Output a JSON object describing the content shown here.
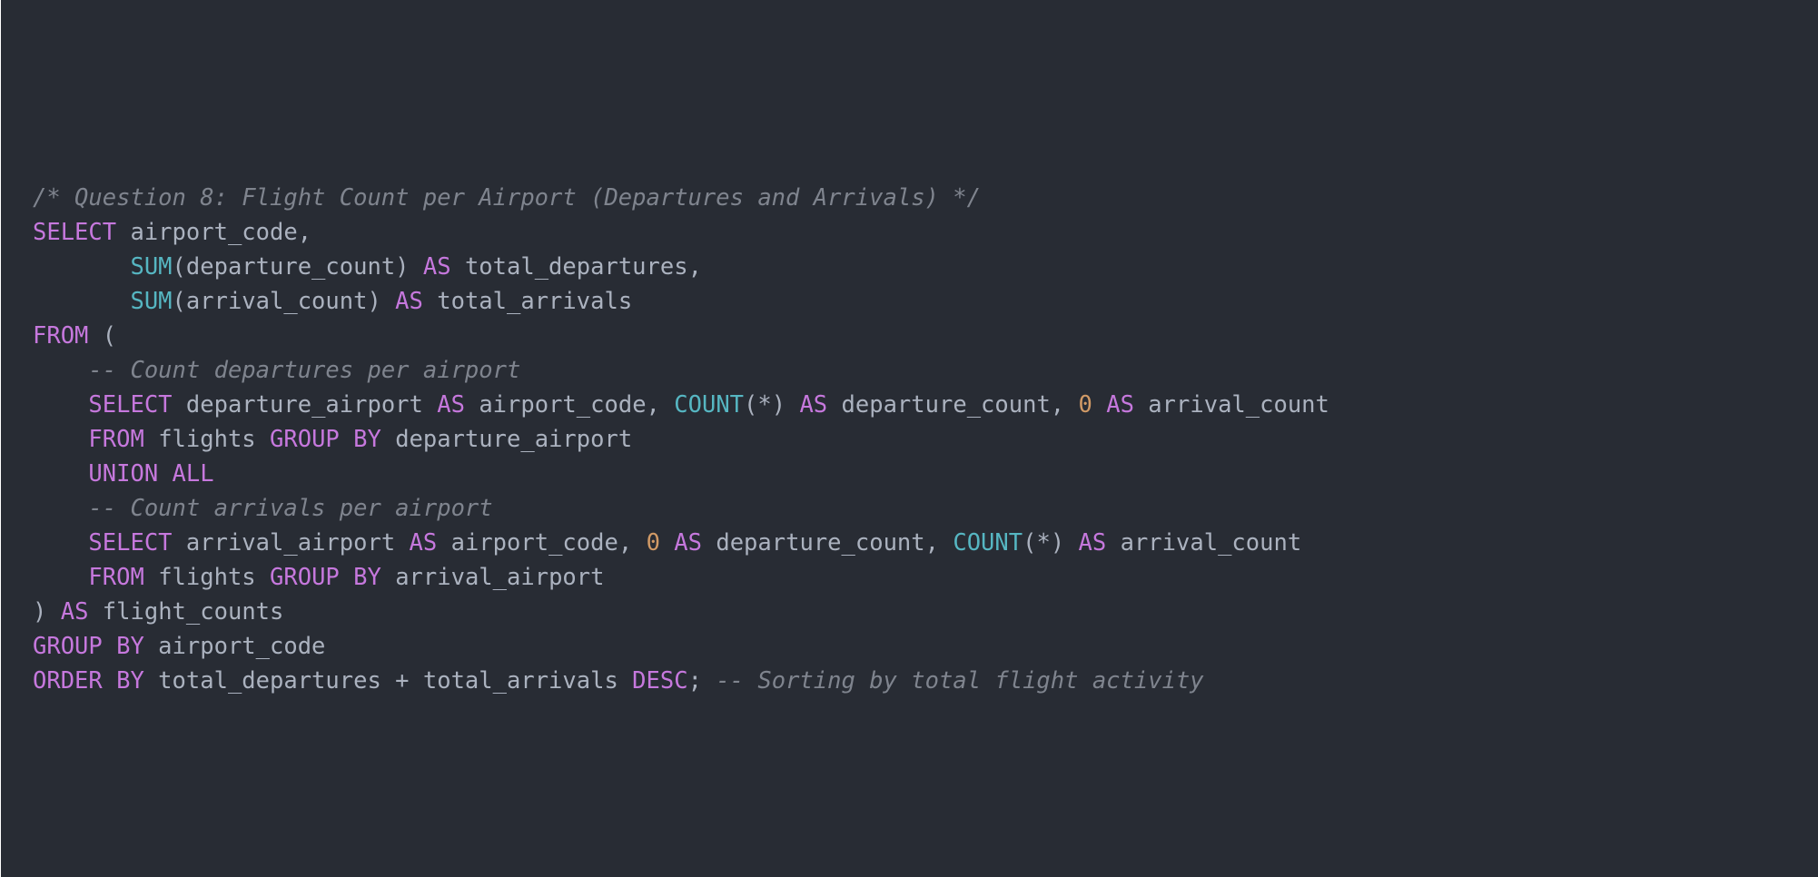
{
  "editor": {
    "language": "sql",
    "theme": "dark",
    "colors": {
      "background": "#282c34",
      "text": "#abb2bf",
      "keyword": "#c678dd",
      "function": "#56b6c2",
      "number": "#d19a66",
      "comment": "#7f848e"
    },
    "lines": [
      [
        {
          "t": "comment",
          "v": "/* Question 8: Flight Count per Airport (Departures and Arrivals) */"
        }
      ],
      [
        {
          "t": "keyword",
          "v": "SELECT"
        },
        {
          "t": "plain",
          "v": " airport_code,"
        }
      ],
      [
        {
          "t": "plain",
          "v": "       "
        },
        {
          "t": "function",
          "v": "SUM"
        },
        {
          "t": "plain",
          "v": "(departure_count) "
        },
        {
          "t": "keyword",
          "v": "AS"
        },
        {
          "t": "plain",
          "v": " total_departures,"
        }
      ],
      [
        {
          "t": "plain",
          "v": "       "
        },
        {
          "t": "function",
          "v": "SUM"
        },
        {
          "t": "plain",
          "v": "(arrival_count) "
        },
        {
          "t": "keyword",
          "v": "AS"
        },
        {
          "t": "plain",
          "v": " total_arrivals"
        }
      ],
      [
        {
          "t": "keyword",
          "v": "FROM"
        },
        {
          "t": "plain",
          "v": " ("
        }
      ],
      [
        {
          "t": "plain",
          "v": "    "
        },
        {
          "t": "comment",
          "v": "-- Count departures per airport"
        }
      ],
      [
        {
          "t": "plain",
          "v": "    "
        },
        {
          "t": "keyword",
          "v": "SELECT"
        },
        {
          "t": "plain",
          "v": " departure_airport "
        },
        {
          "t": "keyword",
          "v": "AS"
        },
        {
          "t": "plain",
          "v": " airport_code, "
        },
        {
          "t": "function",
          "v": "COUNT"
        },
        {
          "t": "plain",
          "v": "(*) "
        },
        {
          "t": "keyword",
          "v": "AS"
        },
        {
          "t": "plain",
          "v": " departure_count, "
        },
        {
          "t": "number",
          "v": "0"
        },
        {
          "t": "plain",
          "v": " "
        },
        {
          "t": "keyword",
          "v": "AS"
        },
        {
          "t": "plain",
          "v": " arrival_count"
        }
      ],
      [
        {
          "t": "plain",
          "v": "    "
        },
        {
          "t": "keyword",
          "v": "FROM"
        },
        {
          "t": "plain",
          "v": " flights "
        },
        {
          "t": "keyword",
          "v": "GROUP BY"
        },
        {
          "t": "plain",
          "v": " departure_airport"
        }
      ],
      [
        {
          "t": "plain",
          "v": "    "
        },
        {
          "t": "keyword",
          "v": "UNION ALL"
        }
      ],
      [
        {
          "t": "plain",
          "v": "    "
        },
        {
          "t": "comment",
          "v": "-- Count arrivals per airport"
        }
      ],
      [
        {
          "t": "plain",
          "v": "    "
        },
        {
          "t": "keyword",
          "v": "SELECT"
        },
        {
          "t": "plain",
          "v": " arrival_airport "
        },
        {
          "t": "keyword",
          "v": "AS"
        },
        {
          "t": "plain",
          "v": " airport_code, "
        },
        {
          "t": "number",
          "v": "0"
        },
        {
          "t": "plain",
          "v": " "
        },
        {
          "t": "keyword",
          "v": "AS"
        },
        {
          "t": "plain",
          "v": " departure_count, "
        },
        {
          "t": "function",
          "v": "COUNT"
        },
        {
          "t": "plain",
          "v": "(*) "
        },
        {
          "t": "keyword",
          "v": "AS"
        },
        {
          "t": "plain",
          "v": " arrival_count"
        }
      ],
      [
        {
          "t": "plain",
          "v": "    "
        },
        {
          "t": "keyword",
          "v": "FROM"
        },
        {
          "t": "plain",
          "v": " flights "
        },
        {
          "t": "keyword",
          "v": "GROUP BY"
        },
        {
          "t": "plain",
          "v": " arrival_airport"
        }
      ],
      [
        {
          "t": "plain",
          "v": ") "
        },
        {
          "t": "keyword",
          "v": "AS"
        },
        {
          "t": "plain",
          "v": " flight_counts"
        }
      ],
      [
        {
          "t": "keyword",
          "v": "GROUP BY"
        },
        {
          "t": "plain",
          "v": " airport_code"
        }
      ],
      [
        {
          "t": "keyword",
          "v": "ORDER BY"
        },
        {
          "t": "plain",
          "v": " total_departures + total_arrivals "
        },
        {
          "t": "keyword",
          "v": "DESC"
        },
        {
          "t": "plain",
          "v": "; "
        },
        {
          "t": "comment",
          "v": "-- Sorting by total flight activity"
        }
      ]
    ]
  }
}
